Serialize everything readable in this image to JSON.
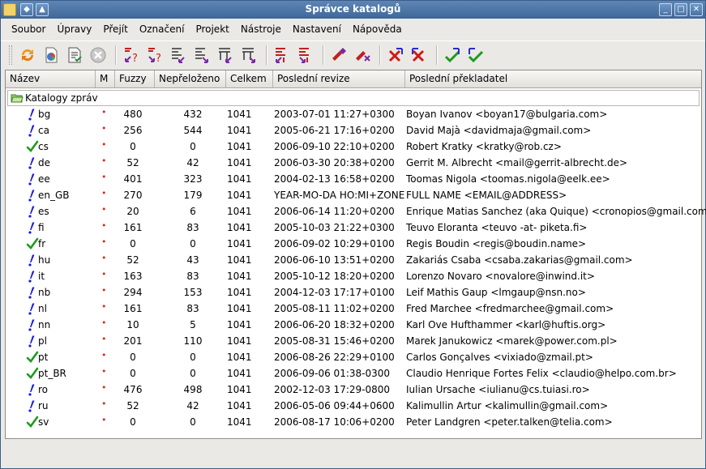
{
  "window": {
    "title": "Správce katalogů"
  },
  "menu": [
    "Soubor",
    "Úpravy",
    "Přejít",
    "Označení",
    "Projekt",
    "Nástroje",
    "Nastavení",
    "Nápověda"
  ],
  "toolbar": {
    "groups": [
      [
        "reload-icon",
        "statistics-icon",
        "file-status-icon",
        "stop-icon"
      ],
      [
        "next-untranslated-icon",
        "prev-fuzzy-icon",
        "next-fuzzy-icon",
        "prev-untranslated-icon",
        "next-error-icon",
        "prev-error-icon"
      ],
      [
        "next-marked-icon",
        "prev-marked-icon"
      ],
      [
        "mark-icon",
        "unmark-icon"
      ],
      [
        "delete-icon",
        "delete-all-icon"
      ],
      [
        "check-icon",
        "check-all-icon"
      ]
    ]
  },
  "columns": [
    "Název",
    "M",
    "Fuzzy",
    "Nepřeloženo",
    "Celkem",
    "Poslední revize",
    "Poslední překladatel"
  ],
  "group_label": "Katalogy zpráv",
  "colors": {
    "titlebar": "#4a72a2",
    "incomplete": "#1a1ae0",
    "complete": "#1f9a1f",
    "mark_dot": "#d03030"
  },
  "rows": [
    {
      "status": "incomplete",
      "name": "bg",
      "marked": "•",
      "fuzzy": "480",
      "untranslated": "432",
      "total": "1041",
      "revision": "2003-07-01 11:27+0300",
      "translator": "Boyan Ivanov <boyan17@bulgaria.com>"
    },
    {
      "status": "incomplete",
      "name": "ca",
      "marked": "•",
      "fuzzy": "256",
      "untranslated": "544",
      "total": "1041",
      "revision": "2005-06-21 17:16+0200",
      "translator": "David Majà <davidmaja@gmail.com>"
    },
    {
      "status": "complete",
      "name": "cs",
      "marked": "•",
      "fuzzy": "0",
      "untranslated": "0",
      "total": "1041",
      "revision": "2006-09-10 22:10+0200",
      "translator": "Robert Kratky <kratky@rob.cz>"
    },
    {
      "status": "incomplete",
      "name": "de",
      "marked": "•",
      "fuzzy": "52",
      "untranslated": "42",
      "total": "1041",
      "revision": "2006-03-30 20:38+0200",
      "translator": "Gerrit M. Albrecht <mail@gerrit-albrecht.de>"
    },
    {
      "status": "incomplete",
      "name": "ee",
      "marked": "•",
      "fuzzy": "401",
      "untranslated": "323",
      "total": "1041",
      "revision": "2004-02-13 16:58+0200",
      "translator": "Toomas Nigola <toomas.nigola@eelk.ee>"
    },
    {
      "status": "incomplete",
      "name": "en_GB",
      "marked": "•",
      "fuzzy": "270",
      "untranslated": "179",
      "total": "1041",
      "revision": "YEAR-MO-DA HO:MI+ZONE",
      "translator": "FULL NAME <EMAIL@ADDRESS>"
    },
    {
      "status": "incomplete",
      "name": "es",
      "marked": "•",
      "fuzzy": "20",
      "untranslated": "6",
      "total": "1041",
      "revision": "2006-06-14 11:20+0200",
      "translator": "Enrique Matias Sanchez (aka Quique) <cronopios@gmail.com>"
    },
    {
      "status": "incomplete",
      "name": "fi",
      "marked": "•",
      "fuzzy": "161",
      "untranslated": "83",
      "total": "1041",
      "revision": "2005-10-03 21:22+0300",
      "translator": "Teuvo Eloranta <teuvo -at- piketa.fi>"
    },
    {
      "status": "complete",
      "name": "fr",
      "marked": "•",
      "fuzzy": "0",
      "untranslated": "0",
      "total": "1041",
      "revision": "2006-09-02 10:29+0100",
      "translator": "Regis Boudin <regis@boudin.name>"
    },
    {
      "status": "incomplete",
      "name": "hu",
      "marked": "•",
      "fuzzy": "52",
      "untranslated": "43",
      "total": "1041",
      "revision": "2006-06-10 13:51+0200",
      "translator": "Zakariás Csaba <csaba.zakarias@gmail.com>"
    },
    {
      "status": "incomplete",
      "name": "it",
      "marked": "•",
      "fuzzy": "163",
      "untranslated": "83",
      "total": "1041",
      "revision": "2005-10-12 18:20+0200",
      "translator": "Lorenzo Novaro <novalore@inwind.it>"
    },
    {
      "status": "incomplete",
      "name": "nb",
      "marked": "•",
      "fuzzy": "294",
      "untranslated": "153",
      "total": "1041",
      "revision": "2004-12-03 17:17+0100",
      "translator": "Leif Mathis Gaup <lmgaup@nsn.no>"
    },
    {
      "status": "incomplete",
      "name": "nl",
      "marked": "•",
      "fuzzy": "161",
      "untranslated": "83",
      "total": "1041",
      "revision": "2005-08-11 11:02+0200",
      "translator": "Fred Marchee <fredmarchee@gmail.com>"
    },
    {
      "status": "incomplete",
      "name": "nn",
      "marked": "•",
      "fuzzy": "10",
      "untranslated": "5",
      "total": "1041",
      "revision": "2006-06-20 18:32+0200",
      "translator": "Karl Ove Hufthammer <karl@huftis.org>"
    },
    {
      "status": "incomplete",
      "name": "pl",
      "marked": "•",
      "fuzzy": "201",
      "untranslated": "110",
      "total": "1041",
      "revision": "2005-08-31 15:46+0200",
      "translator": "Marek Janukowicz <marek@power.com.pl>"
    },
    {
      "status": "complete",
      "name": "pt",
      "marked": "•",
      "fuzzy": "0",
      "untranslated": "0",
      "total": "1041",
      "revision": "2006-08-26 22:29+0100",
      "translator": "Carlos Gonçalves <vixiado@zmail.pt>"
    },
    {
      "status": "complete",
      "name": "pt_BR",
      "marked": "•",
      "fuzzy": "0",
      "untranslated": "0",
      "total": "1041",
      "revision": "2006-09-06 01:38-0300",
      "translator": "Claudio Henrique Fortes Felix <claudio@helpo.com.br>"
    },
    {
      "status": "incomplete",
      "name": "ro",
      "marked": "•",
      "fuzzy": "476",
      "untranslated": "498",
      "total": "1041",
      "revision": "2002-12-03 17:29-0800",
      "translator": "Iulian Ursache <iulianu@cs.tuiasi.ro>"
    },
    {
      "status": "incomplete",
      "name": "ru",
      "marked": "•",
      "fuzzy": "52",
      "untranslated": "42",
      "total": "1041",
      "revision": "2006-05-06 09:44+0600",
      "translator": "Kalimullin Artur <kalimullin@gmail.com>"
    },
    {
      "status": "complete",
      "name": "sv",
      "marked": "•",
      "fuzzy": "0",
      "untranslated": "0",
      "total": "1041",
      "revision": "2006-08-17 10:06+0200",
      "translator": "Peter Landgren <peter.talken@telia.com>"
    }
  ]
}
